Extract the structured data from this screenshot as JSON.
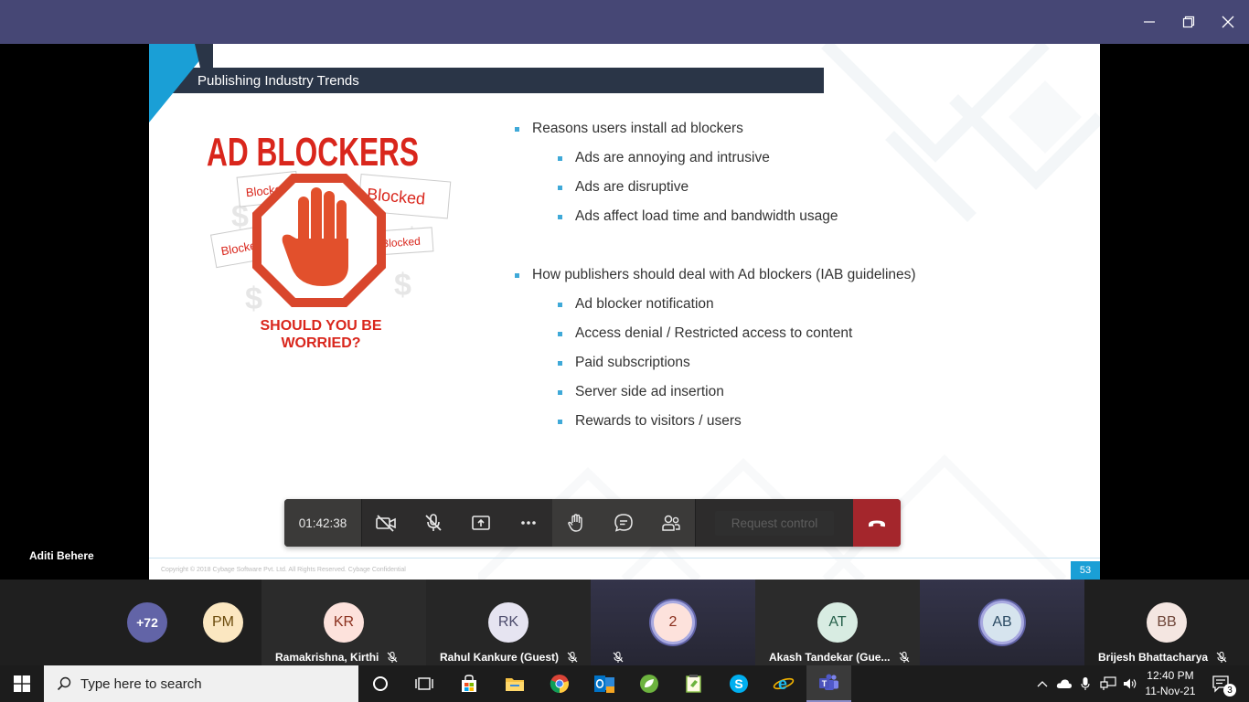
{
  "window": {
    "controls": [
      "minimize-icon",
      "restore-icon",
      "close-icon"
    ]
  },
  "slide": {
    "section_title": "Publishing Industry Trends",
    "graphic": {
      "headline": "AD BLOCKERS",
      "stamp_words": [
        "Blocked",
        "Blocked",
        "Blocked",
        "Blocked"
      ],
      "caption_line1": "SHOULD YOU BE",
      "caption_line2": "WORRIED?"
    },
    "bullets": [
      {
        "text": "Reasons users install ad blockers",
        "sub": [
          "Ads are annoying and intrusive",
          "Ads are disruptive",
          "Ads affect load time and bandwidth usage"
        ]
      },
      {
        "text": "How publishers should deal with Ad blockers (IAB guidelines)",
        "sub": [
          "Ad blocker notification",
          "Access denial / Restricted access to content",
          "Paid subscriptions",
          "Server side ad insertion",
          "Rewards to visitors / users"
        ]
      }
    ],
    "footer_copyright": "Copyright © 2018 Cybage Software Pvt. Ltd. All Rights Reserved. Cybage Confidential",
    "page_number": "53",
    "accent_color": "#1a9fd6",
    "title_bar_color": "#2a3547"
  },
  "presenter_name": "Aditi Behere",
  "call_controls": {
    "timer": "01:42:38",
    "buttons": [
      "camera-off-icon",
      "mic-off-icon",
      "share-screen-icon",
      "more-icon",
      "raise-hand-icon",
      "chat-icon",
      "participants-icon"
    ],
    "request_control_label": "Request control",
    "hangup": "hang-up-icon"
  },
  "participants": {
    "overflow_count": "+72",
    "tiles": [
      {
        "initials": "PM",
        "name": "",
        "bg": "#fbe7c1",
        "fg": "#6a4a0b"
      },
      {
        "initials": "KR",
        "name": "Ramakrishna, Kirthi",
        "bg": "#fde2dc",
        "fg": "#8a2f1d"
      },
      {
        "initials": "RK",
        "name": "Rahul Kankure (Guest)",
        "bg": "#e6e4f1",
        "fg": "#4b4a6b"
      },
      {
        "initials": "2",
        "name": "",
        "bg": "#fde2dc",
        "fg": "#8a2f1d"
      },
      {
        "initials": "AT",
        "name": "Akash Tandekar (Gue...",
        "bg": "#d8ece2",
        "fg": "#26604a"
      },
      {
        "initials": "AB",
        "name": "",
        "bg": "#d6e4ee",
        "fg": "#2a4a63"
      },
      {
        "initials": "BB",
        "name": "Brijesh Bhattacharya",
        "bg": "#f4e6e1",
        "fg": "#6e4538"
      }
    ]
  },
  "taskbar": {
    "search_placeholder": "Type here to search",
    "apps": [
      "cortana-icon",
      "task-view-icon",
      "store-icon",
      "file-explorer-icon",
      "chrome-icon",
      "outlook-icon",
      "spring-tool-icon",
      "notepad-plus-icon",
      "skype-icon",
      "internet-explorer-icon",
      "teams-icon"
    ],
    "time": "12:40 PM",
    "date": "11-Nov-21",
    "notification_count": "3"
  }
}
